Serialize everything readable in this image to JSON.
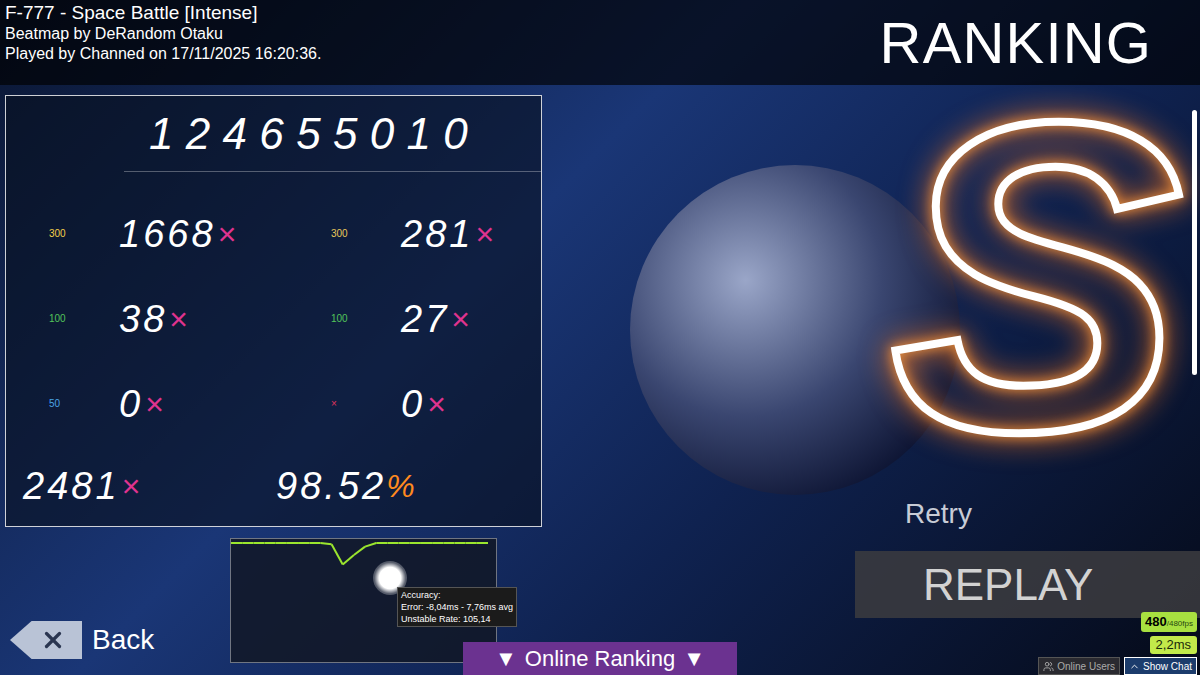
{
  "header": {
    "title": "F-777 - Space Battle [Intense]",
    "beatmap": "Beatmap by DeRandom Otaku",
    "played": "Played by Channed on 17/11/2025 16:20:36.",
    "heading": "RANKING"
  },
  "score": "124655010",
  "multiplier": "×",
  "hits": [
    {
      "label": "300",
      "value": "1668",
      "color": "#f2cf4a"
    },
    {
      "label": "300",
      "value": "281",
      "color": "#e8c85a"
    },
    {
      "label": "100",
      "value": "38",
      "color": "#52c45a"
    },
    {
      "label": "100",
      "value": "27",
      "color": "#52c45a"
    },
    {
      "label": "50",
      "value": "0",
      "color": "#4aa3e6"
    },
    {
      "label": "×",
      "value": "0",
      "color": "#e0335e"
    }
  ],
  "combo": "2481",
  "accuracy": "98.52",
  "accuracy_unit": "%",
  "grade": "S",
  "graph": {
    "hp": [
      1,
      1,
      1,
      1,
      1,
      1,
      1,
      1,
      1,
      0.99,
      0.82,
      0.9,
      0.97,
      1,
      1,
      1,
      1,
      1,
      1,
      1,
      1,
      1,
      1,
      1
    ],
    "tooltip": [
      "Accuracy:",
      "Error: -8,04ms - 7,76ms avg",
      "Unstable Rate: 105,14"
    ]
  },
  "retry": "Retry",
  "replay": "REPLAY",
  "back": "Back",
  "online_ranking": {
    "label": "Online Ranking",
    "arrow": "▼"
  },
  "fps": {
    "current": "480",
    "target": "/480fps",
    "frame_time": "2,2ms"
  },
  "footer_buttons": [
    {
      "label": "Online Users",
      "selected": false
    },
    {
      "label": "Show Chat",
      "selected": true
    }
  ]
}
